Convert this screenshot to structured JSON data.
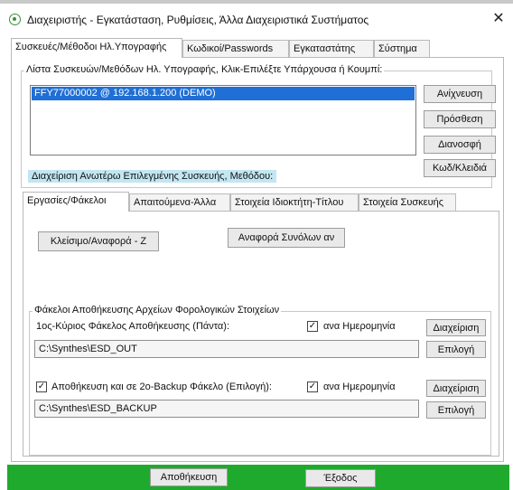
{
  "window": {
    "title": "Διαχειριστής - Εγκατάσταση, Ρυθμίσεις, Άλλα Διαχειριστικά Συστήματος",
    "close_glyph": "✕"
  },
  "main_tabs": [
    {
      "label": "Συσκευές/Μέθοδοι Ηλ.Υπογραφής"
    },
    {
      "label": "Κωδικοί/Passwords"
    },
    {
      "label": "Εγκαταστάτης"
    },
    {
      "label": "Σύστημα"
    }
  ],
  "devices": {
    "group_title": "Λίστα Συσκευών/Μεθόδων Ηλ. Υπογραφής, Κλικ-Επιλέξτε Υπάρχουσα ή Κουμπί:",
    "items": [
      "FFY77000002 @ 192.168.1.200 (DEMO)"
    ],
    "buttons": {
      "detect": "Ανίχνευση",
      "add": "Πρόσθεση",
      "delete": "Διανοσφή",
      "codes": "Κωδ/Κλειδιά"
    },
    "manage_label": "Διαχείριση Ανωτέρω Επιλεγμένης Συσκευής, Μεθόδου:"
  },
  "sub_tabs": [
    {
      "label": "Εργασίες/Φάκελοι"
    },
    {
      "label": "Απαιτούμενα-Άλλα"
    },
    {
      "label": "Στοιχεία Ιδιοκτήτη-Τίτλου"
    },
    {
      "label": "Στοιχεία Συσκευής"
    }
  ],
  "tasks": {
    "close_report": "Κλείσιμο/Αναφορά - Ζ",
    "totals_report": "Αναφορά Συνόλων αν"
  },
  "folders": {
    "group_title": "Φάκελοι Αποθήκευσης Αρχείων Φορολογικών Στοιχείων",
    "primary_label": "1ος-Κύριος Φάκελος Αποθήκευσης (Πάντα):",
    "primary_date_check": "ανα Ημερομηνία",
    "primary_manage": "Διαχείριση",
    "primary_path": "C:\\Synthes\\ESD_OUT",
    "primary_select": "Επιλογή",
    "backup_label": "Αποθήκευση και σε 2ο-Backup Φάκελο (Επιλογή):",
    "backup_date_check": "ανα Ημερομηνία",
    "backup_manage": "Διαχείριση",
    "backup_path": "C:\\Synthes\\ESD_BACKUP",
    "backup_select": "Επιλογή",
    "check_glyph": "✓"
  },
  "footer": {
    "save": "Αποθήκευση",
    "exit": "Έξοδος"
  },
  "colors": {
    "selection": "#1f6fd6",
    "info_label_bg": "#c2e6f2",
    "footer_bar": "#1faa2e",
    "app_icon": "#3a8f3a"
  }
}
